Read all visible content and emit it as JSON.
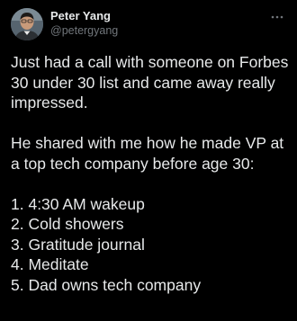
{
  "tweet": {
    "display_name": "Peter Yang",
    "handle": "@petergyang",
    "more_icon": "more-horizontal-icon",
    "paragraphs": [
      "Just had a call with someone on Forbes 30 under 30 list and came away really impressed.",
      "He shared with me how he made VP at a top tech company before age 30:"
    ],
    "list": [
      "1. 4:30 AM wakeup",
      "2. Cold showers",
      "3. Gratitude journal",
      "4. Meditate",
      "5. Dad owns tech company"
    ]
  },
  "colors": {
    "background": "#000000",
    "primary_text": "#e7e9ea",
    "secondary_text": "#71767b"
  }
}
